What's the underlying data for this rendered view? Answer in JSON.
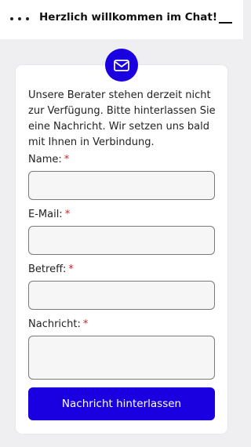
{
  "header": {
    "title": "Herzlich willkommen im Chat!",
    "menu_icon": "more-dots-icon",
    "minimize_icon": "minimize-icon"
  },
  "badge": {
    "icon": "envelope-icon"
  },
  "form": {
    "message": "Unsere Berater stehen derzeit nicht zur Verfügung. Bitte hinterlassen Sie eine Nachricht. Wir setzen uns bald mit Ihnen in Verbindung.",
    "required_marker": "*",
    "fields": [
      {
        "label": "Name:",
        "value": ""
      },
      {
        "label": "E-Mail:",
        "value": ""
      },
      {
        "label": "Betreff:",
        "value": ""
      },
      {
        "label": "Nachricht:",
        "value": ""
      }
    ],
    "submit_label": "Nachricht hinterlassen"
  },
  "colors": {
    "accent": "#1a00e0",
    "required": "#c62828",
    "background": "#efeff2"
  }
}
